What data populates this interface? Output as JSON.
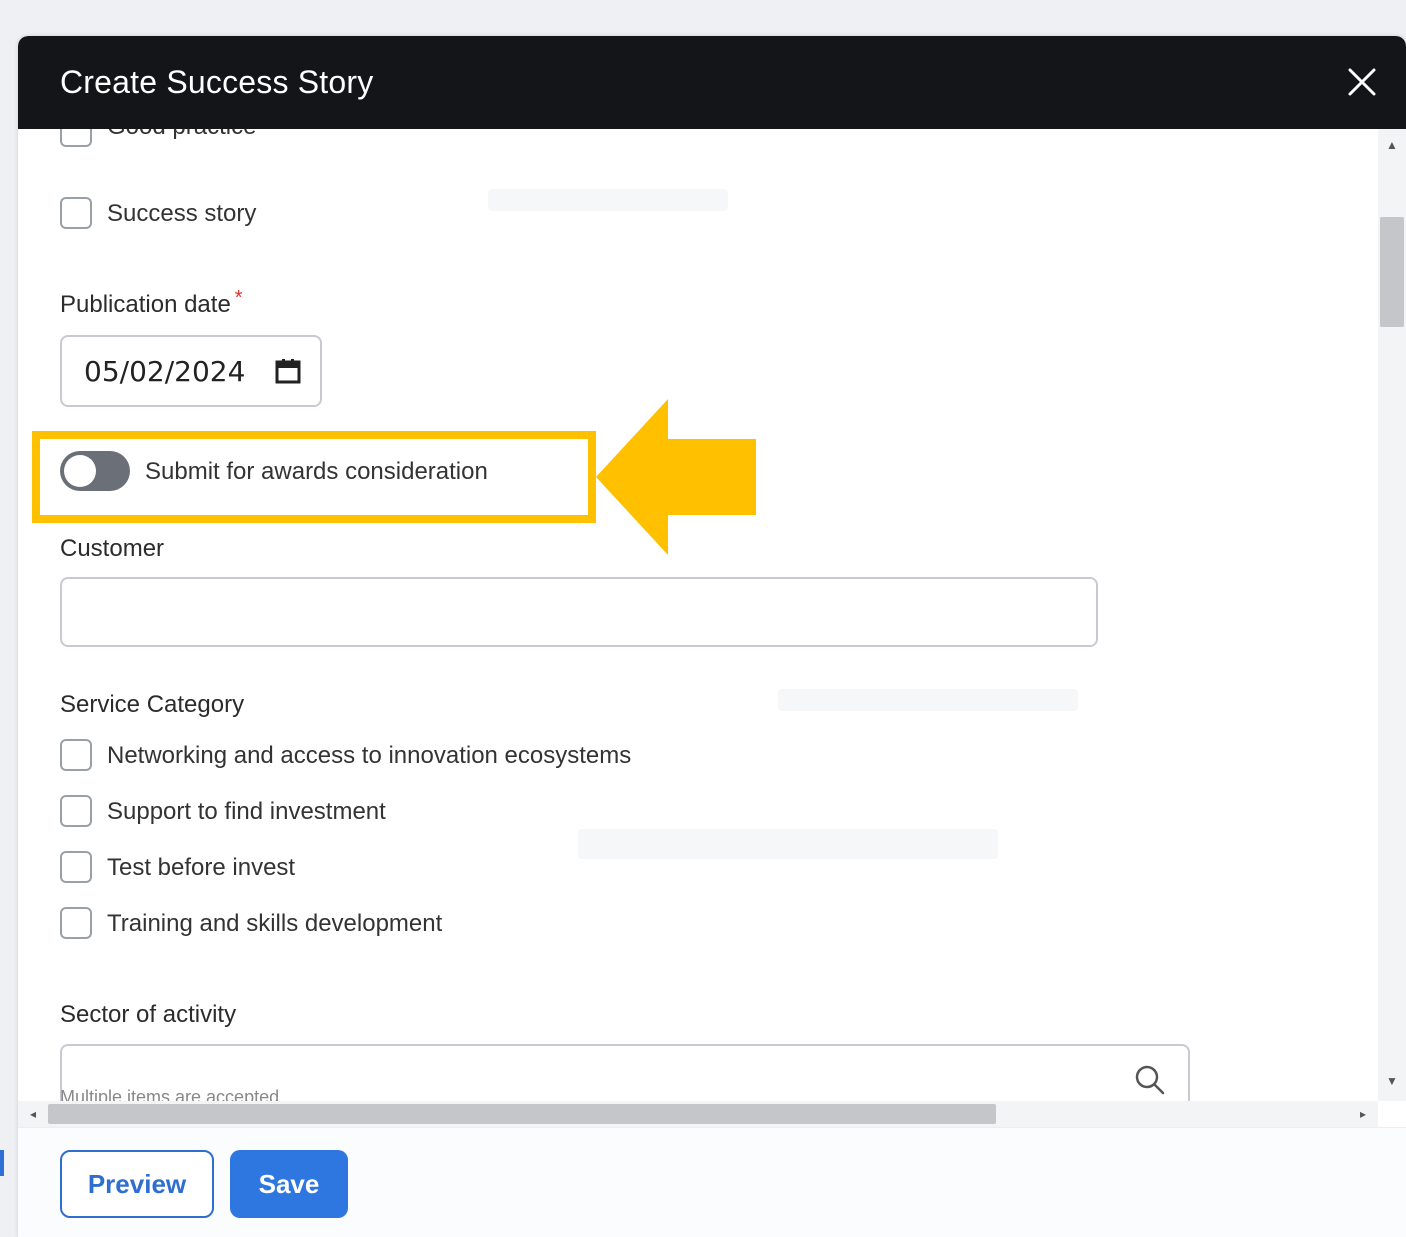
{
  "modal": {
    "title": "Create Success Story"
  },
  "type_options": [
    {
      "label": "Good practice",
      "checked": false
    },
    {
      "label": "Success story",
      "checked": false
    }
  ],
  "publication_date": {
    "label": "Publication date",
    "required_mark": "*",
    "value": "05/02/2024"
  },
  "awards_toggle": {
    "label": "Submit for awards consideration",
    "on": false
  },
  "customer": {
    "label": "Customer",
    "value": ""
  },
  "service_category": {
    "label": "Service Category",
    "options": [
      {
        "label": "Networking and access to innovation ecosystems",
        "checked": false
      },
      {
        "label": "Support to find investment",
        "checked": false
      },
      {
        "label": "Test before invest",
        "checked": false
      },
      {
        "label": "Training and skills development",
        "checked": false
      }
    ]
  },
  "sector": {
    "label": "Sector of activity",
    "value": "",
    "hint_partial": "Multiple items are accepted"
  },
  "footer": {
    "preview_label": "Preview",
    "save_label": "Save"
  },
  "colors": {
    "header_bg": "#141518",
    "highlight": "#ffc000",
    "primary": "#2f77e0",
    "required": "#d9342b"
  },
  "icons": [
    "close-icon",
    "calendar-icon",
    "search-icon",
    "arrow-left-callout"
  ]
}
